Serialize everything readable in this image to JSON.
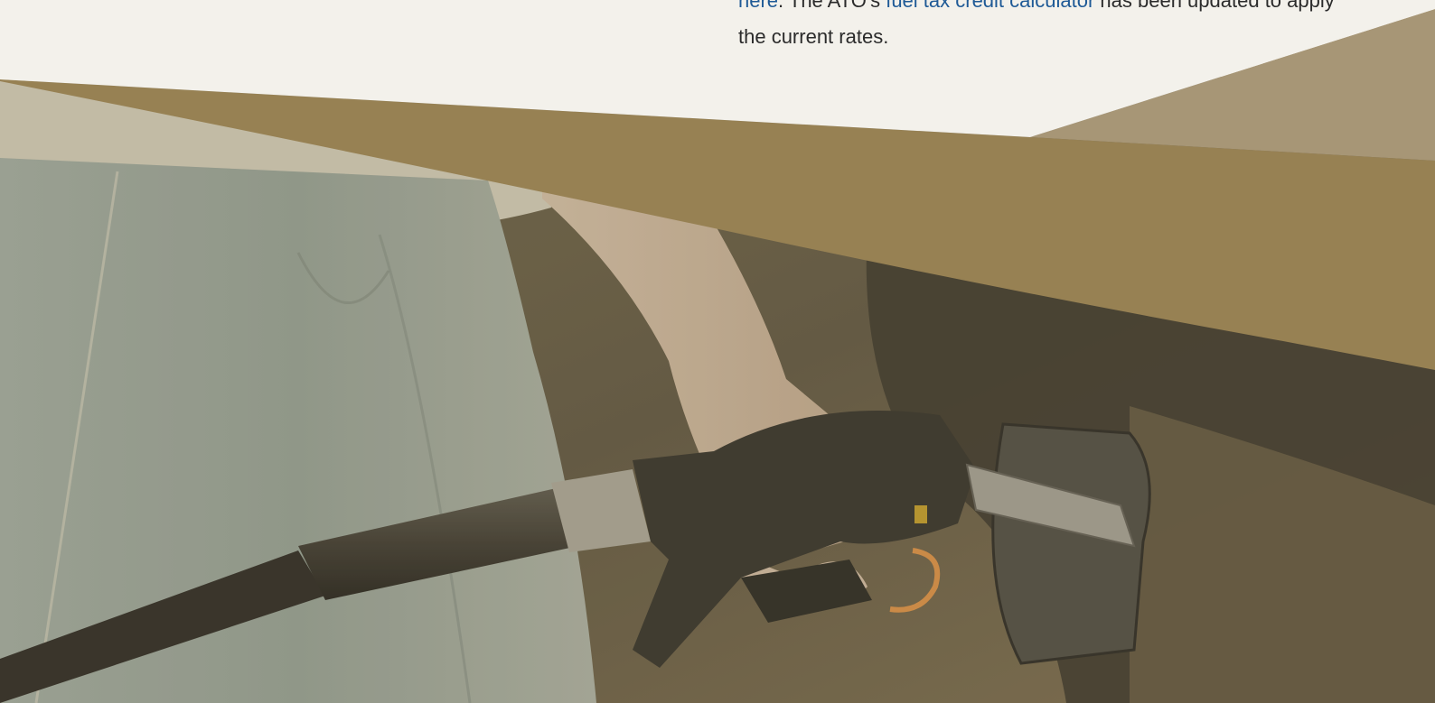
{
  "article": {
    "link_here": "here",
    "text_after_here": ". The ATO's ",
    "link_calculator": "fuel tax credit calculator",
    "text_after_calculator": " has been updated to apply the current rates."
  },
  "hero_image": {
    "subject": "fuel-pump-nozzle-photo"
  },
  "colors": {
    "band": "#978053",
    "band_light": "#a9987a",
    "link": "#1f5a96",
    "text": "#2b2b2b"
  }
}
